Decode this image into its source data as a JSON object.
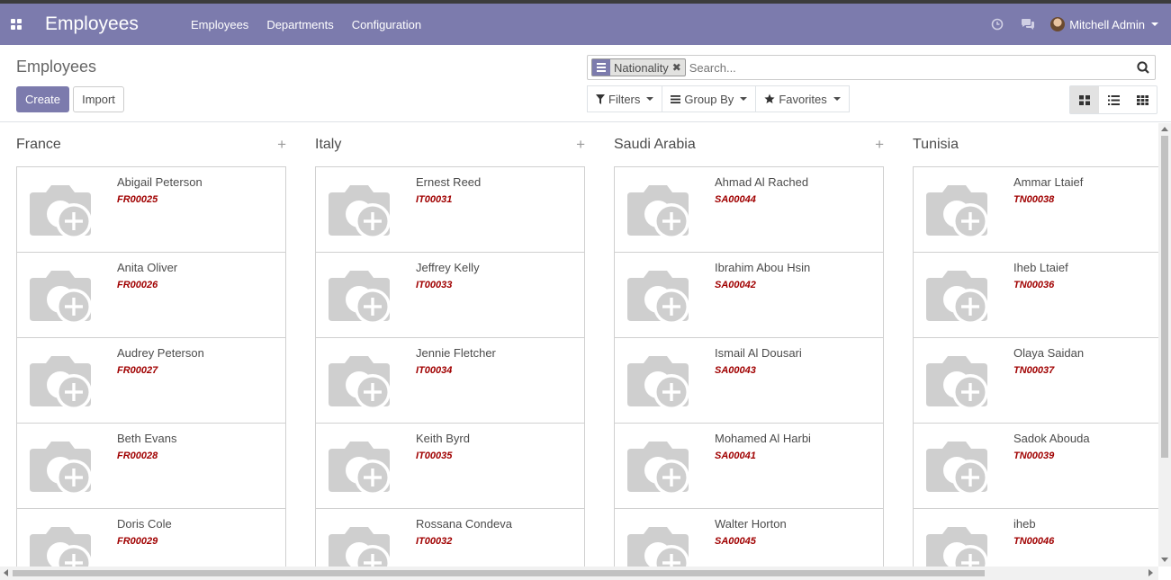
{
  "navbar": {
    "app_title": "Employees",
    "menu": [
      "Employees",
      "Departments",
      "Configuration"
    ],
    "user_name": "Mitchell Admin"
  },
  "breadcrumb": "Employees",
  "buttons": {
    "create": "Create",
    "import": "Import"
  },
  "search": {
    "facet_value": "Nationality",
    "placeholder": "Search..."
  },
  "filters": {
    "filters": "Filters",
    "group_by": "Group By",
    "favorites": "Favorites"
  },
  "columns": [
    {
      "title": "France",
      "cards": [
        {
          "name": "Abigail Peterson",
          "ref": "FR00025"
        },
        {
          "name": "Anita Oliver",
          "ref": "FR00026"
        },
        {
          "name": "Audrey Peterson",
          "ref": "FR00027"
        },
        {
          "name": "Beth Evans",
          "ref": "FR00028"
        },
        {
          "name": "Doris Cole",
          "ref": "FR00029"
        }
      ]
    },
    {
      "title": "Italy",
      "cards": [
        {
          "name": "Ernest Reed",
          "ref": "IT00031"
        },
        {
          "name": "Jeffrey Kelly",
          "ref": "IT00033"
        },
        {
          "name": "Jennie Fletcher",
          "ref": "IT00034"
        },
        {
          "name": "Keith Byrd",
          "ref": "IT00035"
        },
        {
          "name": "Rossana Condeva",
          "ref": "IT00032"
        }
      ]
    },
    {
      "title": "Saudi Arabia",
      "cards": [
        {
          "name": "Ahmad Al Rached",
          "ref": "SA00044"
        },
        {
          "name": "Ibrahim Abou Hsin",
          "ref": "SA00042"
        },
        {
          "name": "Ismail Al Dousari",
          "ref": "SA00043"
        },
        {
          "name": "Mohamed Al Harbi",
          "ref": "SA00041"
        },
        {
          "name": "Walter Horton",
          "ref": "SA00045"
        }
      ]
    },
    {
      "title": "Tunisia",
      "cards": [
        {
          "name": "Ammar Ltaief",
          "ref": "TN00038"
        },
        {
          "name": "Iheb Ltaief",
          "ref": "TN00036"
        },
        {
          "name": "Olaya Saidan",
          "ref": "TN00037"
        },
        {
          "name": "Sadok Abouda",
          "ref": "TN00039"
        },
        {
          "name": "iheb",
          "ref": "TN00046"
        }
      ]
    }
  ],
  "colors": {
    "brand": "#7c7bad",
    "ref_text": "#a00000"
  }
}
